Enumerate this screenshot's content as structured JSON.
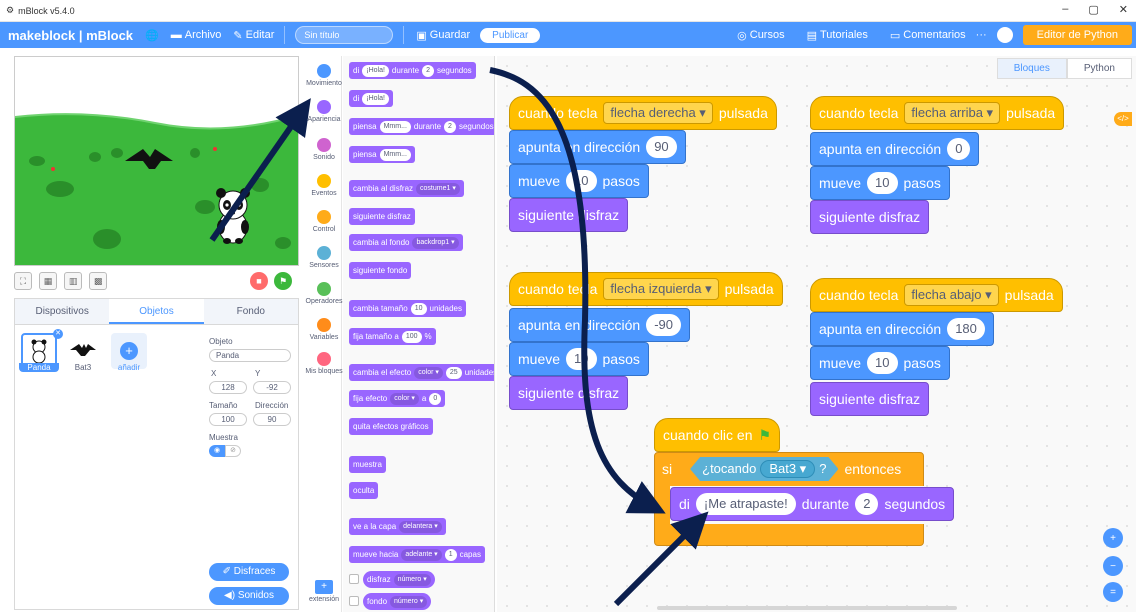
{
  "window": {
    "title": "mBlock v5.4.0",
    "minimize": "–",
    "restore": "▢",
    "close": "✕"
  },
  "menubar": {
    "brand": "makeblock | mBlock",
    "archivo": "Archivo",
    "editar": "Editar",
    "title_placeholder": "Sin título",
    "guardar": "Guardar",
    "publicar": "Publicar",
    "cursos": "Cursos",
    "tutoriales": "Tutoriales",
    "comentarios": "Comentarios",
    "more": "···",
    "python_editor": "Editor de Python"
  },
  "sprite_panel": {
    "tabs": [
      "Dispositivos",
      "Objetos",
      "Fondo"
    ],
    "sprites": [
      {
        "name": "Panda"
      },
      {
        "name": "Bat3"
      }
    ],
    "add_label": "añadir",
    "object_label": "Objeto",
    "object_value": "Panda",
    "x_label": "X",
    "x_value": "128",
    "y_label": "Y",
    "y_value": "-92",
    "size_label": "Tamaño",
    "size_value": "100",
    "direction_label": "Dirección",
    "direction_value": "90",
    "show_label": "Muestra",
    "costumes_btn": "Disfraces",
    "sounds_btn": "Sonidos"
  },
  "categories": [
    {
      "label": "Movimiento",
      "color": "#4c97ff"
    },
    {
      "label": "Apariencia",
      "color": "#9966ff"
    },
    {
      "label": "Sonido",
      "color": "#cf63cf"
    },
    {
      "label": "Eventos",
      "color": "#ffbf00"
    },
    {
      "label": "Control",
      "color": "#ffab19"
    },
    {
      "label": "Sensores",
      "color": "#5cb1d6"
    },
    {
      "label": "Operadores",
      "color": "#59c059"
    },
    {
      "label": "Variables",
      "color": "#ff8c1a"
    },
    {
      "label": "Mis bloques",
      "color": "#ff6680"
    }
  ],
  "extension_label": "extensión",
  "palette": {
    "say_for": {
      "a": "di",
      "b": "¡Hola!",
      "c": "durante",
      "d": "2",
      "e": "segundos"
    },
    "say": {
      "a": "di",
      "b": "¡Hola!"
    },
    "think_for": {
      "a": "piensa",
      "b": "Mmm...",
      "c": "durante",
      "d": "2",
      "e": "segundos"
    },
    "think": {
      "a": "piensa",
      "b": "Mmm..."
    },
    "switch_costume": {
      "a": "cambia al disfraz",
      "b": "costume1 ▾"
    },
    "next_costume": "siguiente disfraz",
    "switch_backdrop": {
      "a": "cambia al fondo",
      "b": "backdrop1 ▾"
    },
    "next_backdrop": "siguiente fondo",
    "change_size": {
      "a": "cambia tamaño",
      "b": "10",
      "c": "unidades"
    },
    "set_size": {
      "a": "fija tamaño a",
      "b": "100",
      "c": "%"
    },
    "change_effect": {
      "a": "cambia el efecto",
      "b": "color ▾",
      "c": "25",
      "d": "unidades"
    },
    "set_effect": {
      "a": "fija efecto",
      "b": "color ▾",
      "c": "a",
      "d": "0"
    },
    "clear_effects": "quita efectos gráficos",
    "show": "muestra",
    "hide": "oculta",
    "go_layer": {
      "a": "ve a la capa",
      "b": "delantera ▾"
    },
    "move_layer": {
      "a": "mueve hacia",
      "b": "adelante ▾",
      "c": "1",
      "d": "capas"
    },
    "costume_reporter": {
      "a": "disfraz",
      "b": "número ▾"
    },
    "backdrop_reporter": {
      "a": "fondo",
      "b": "número ▾"
    }
  },
  "workspace": {
    "tabs": [
      "Bloques",
      "Python"
    ],
    "scripts": {
      "right": {
        "hat_a": "cuando tecla",
        "key": "flecha derecha ▾",
        "hat_b": "pulsada",
        "point": "apunta en dirección",
        "dir": "90",
        "move": "mueve",
        "steps": "10",
        "steps_label": "pasos",
        "next": "siguiente disfraz"
      },
      "up": {
        "hat_a": "cuando tecla",
        "key": "flecha arriba ▾",
        "hat_b": "pulsada",
        "point": "apunta en dirección",
        "dir": "0",
        "move": "mueve",
        "steps": "10",
        "steps_label": "pasos",
        "next": "siguiente disfraz"
      },
      "left": {
        "hat_a": "cuando tecla",
        "key": "flecha izquierda ▾",
        "hat_b": "pulsada",
        "point": "apunta en dirección",
        "dir": "-90",
        "move": "mueve",
        "steps": "10",
        "steps_label": "pasos",
        "next": "siguiente disfraz"
      },
      "down": {
        "hat_a": "cuando tecla",
        "key": "flecha abajo ▾",
        "hat_b": "pulsada",
        "point": "apunta en dirección",
        "dir": "180",
        "move": "mueve",
        "steps": "10",
        "steps_label": "pasos",
        "next": "siguiente disfraz"
      },
      "flag": {
        "hat": "cuando clic en",
        "if": "si",
        "touching": "¿tocando",
        "target": "Bat3 ▾",
        "q": "?",
        "then": "entonces",
        "say": "di",
        "msg": "¡Me atrapaste!",
        "during": "durante",
        "secs": "2",
        "secs_label": "segundos"
      }
    },
    "zoom_in": "+",
    "zoom_out": "−",
    "zoom_reset": "="
  }
}
